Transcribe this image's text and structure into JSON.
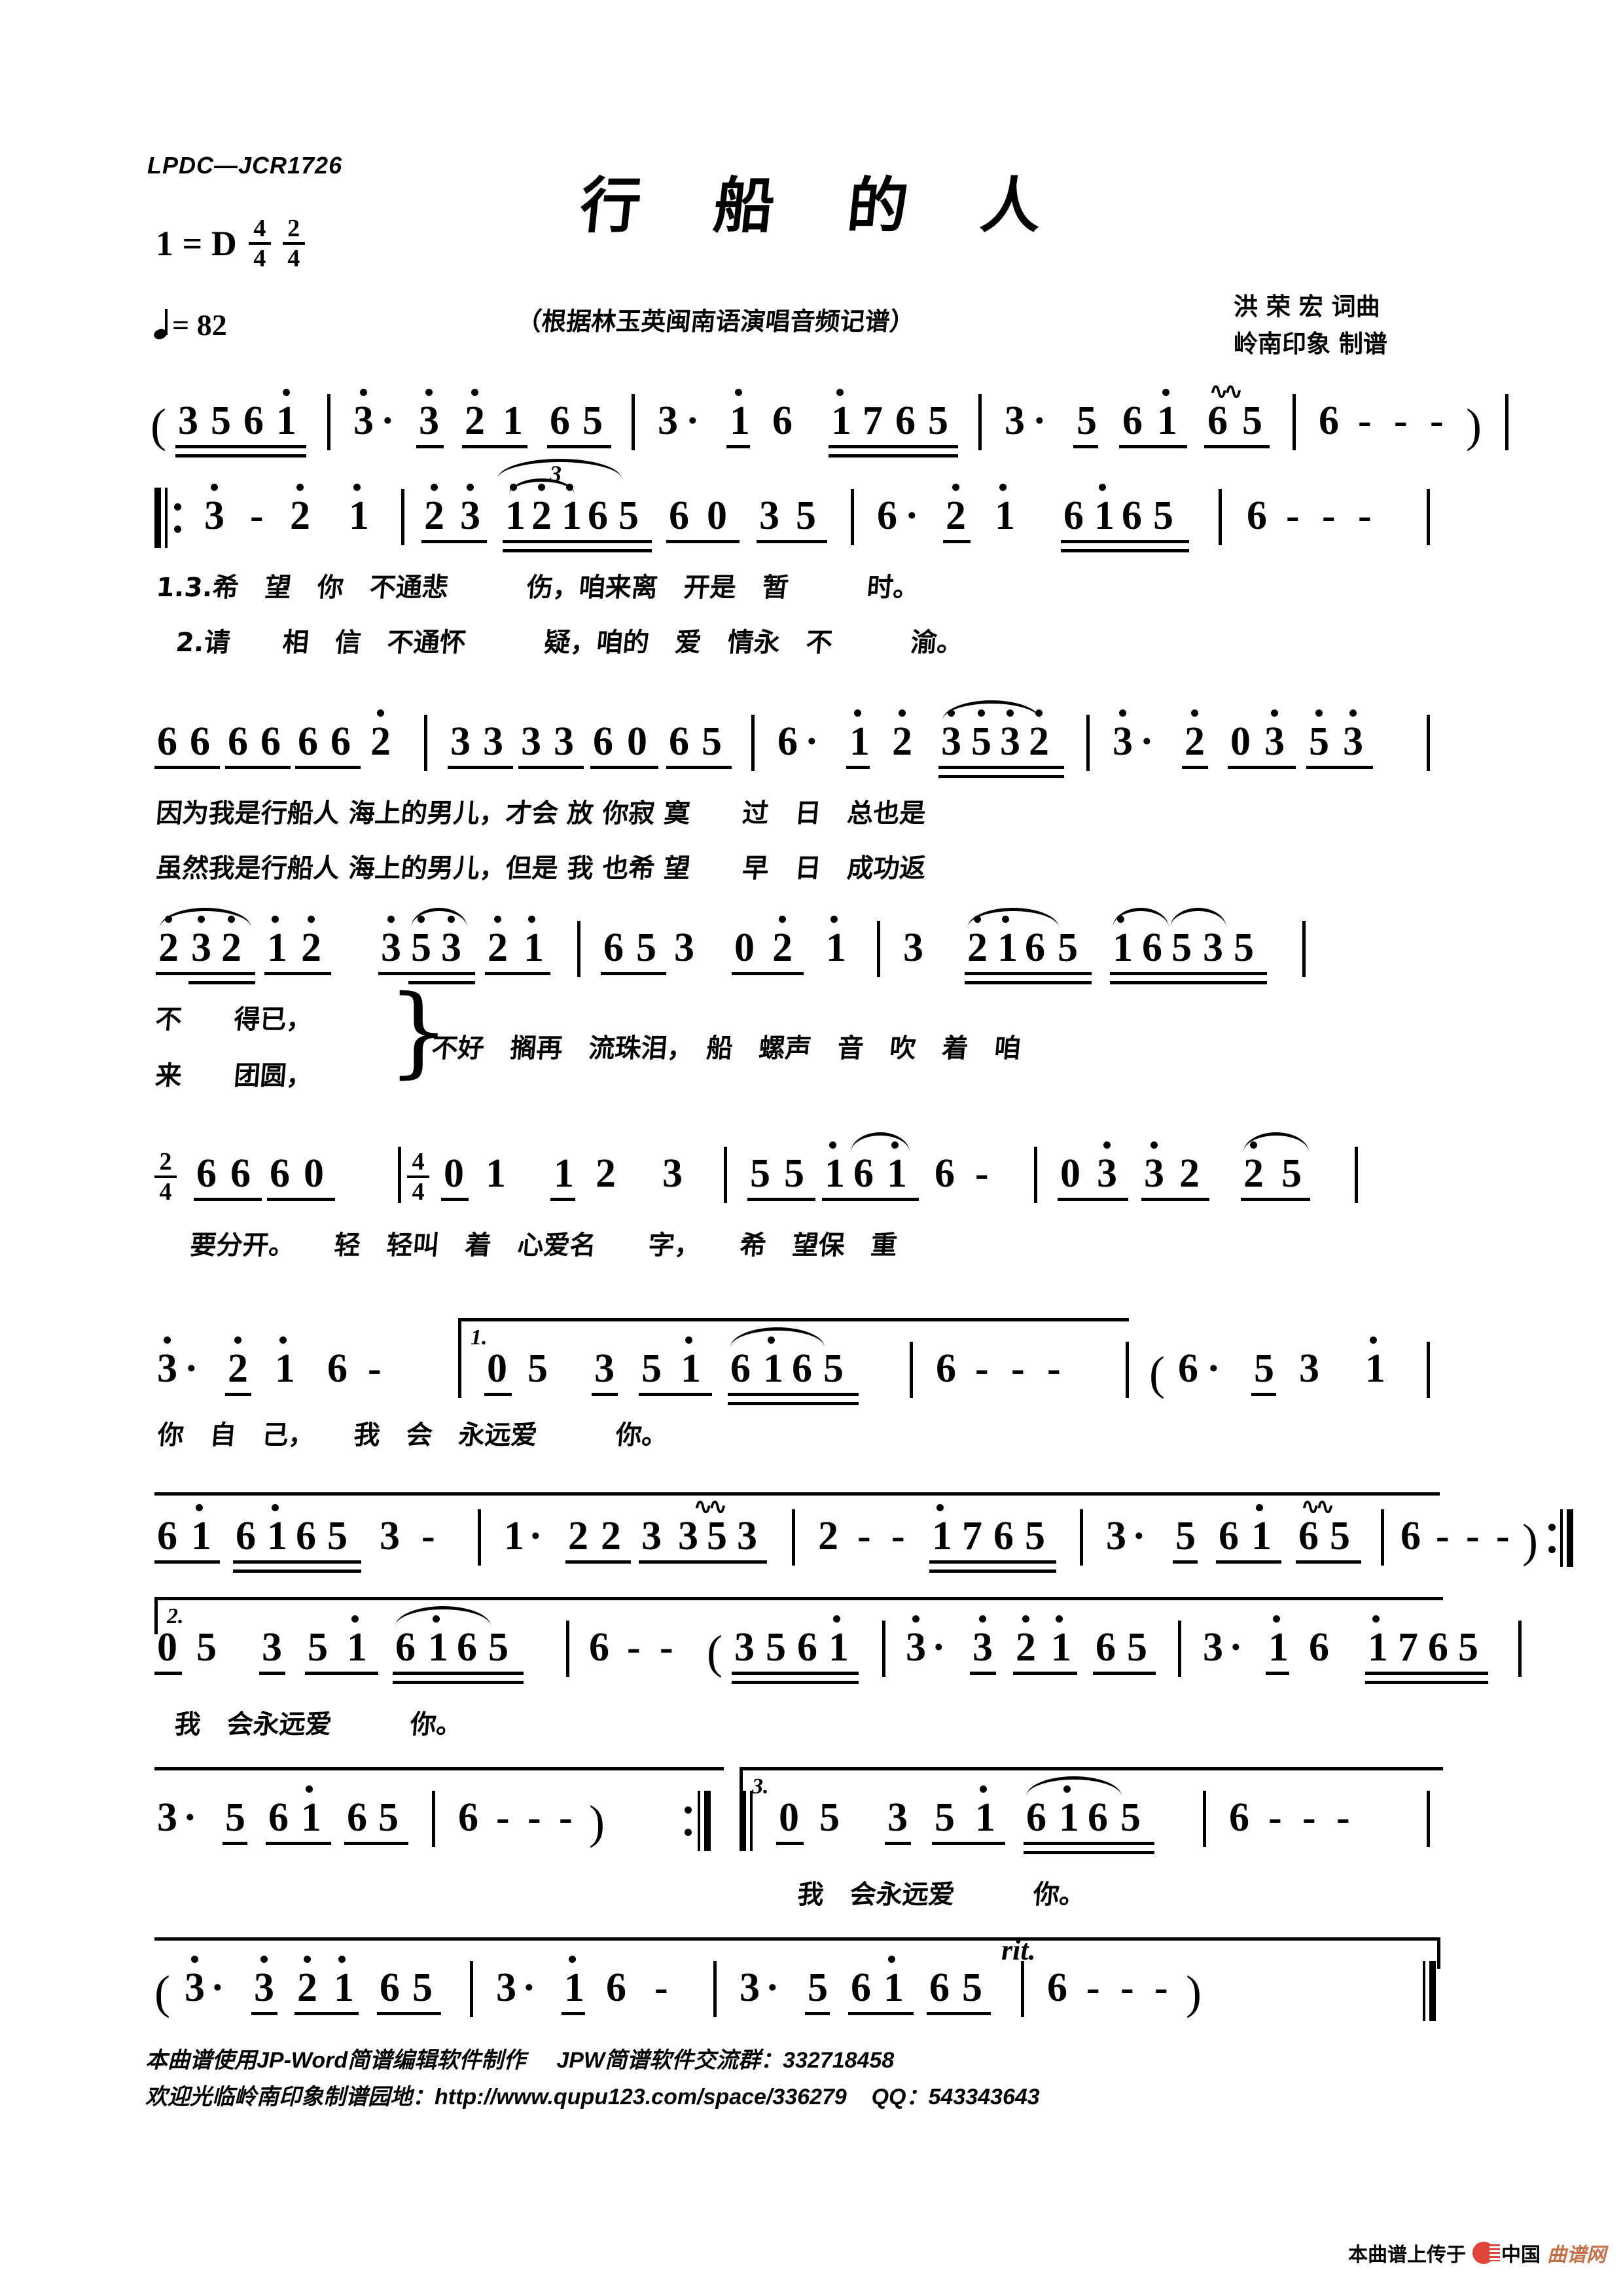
{
  "header": {
    "catalog": "LPDC—JCR1726",
    "title": "行 船 的 人",
    "subtitle": "（根据林玉英闽南语演唱音频记谱）",
    "key_label": "1 = D",
    "time_sig_1": {
      "num": "4",
      "den": "4"
    },
    "time_sig_2": {
      "num": "2",
      "den": "4"
    },
    "tempo_text": "= 82",
    "tempo_note_icon": "quarter-note-icon",
    "credit_lyrics_music": "洪 荣 宏 词曲",
    "credit_arranger": "岭南印象 制谱"
  },
  "score": {
    "systems": [
      {
        "id": "intro",
        "measures": "( 3561 | 3· 3 2 1 6 5 | 3· 1 6 1765 | 3· 5 6 1 6 5 | 6 - - - )",
        "ornament": "mordent",
        "lyrics": []
      },
      {
        "id": "verse-a",
        "measures": "‖: 3 - 2 1 | 2 3 12165 6 0 3 5 | 6· 2 1 6165 | 6 - - -",
        "triplet": "3",
        "lyrics": [
          "1.3.希　望　你　不通悲　　　伤，咱来离　开是　暂　　　时。",
          "2.请　　相　信　不通怀　　　疑，咱的　爱　情永　不　　　渝。"
        ]
      },
      {
        "id": "verse-b",
        "measures": "666666 2 | 3333 6 0 65 | 6· 1 2 3532 | 3· 2 0 3 5 3",
        "lyrics": [
          "因为我是行船人 海上的男儿，才会 放 你寂 寞　　过　日　总也是",
          "虽然我是行船人 海上的男儿，但是 我 也希 望　　早　日　成功返"
        ]
      },
      {
        "id": "verse-c",
        "measures": "232 1 2　353 2 1 | 6 5 3　0 2　1 | 3　2165 16535",
        "lyrics_bracketed": [
          "不　　得已，",
          "来　　团圆，"
        ],
        "lyrics_shared": "不好　搁再　流珠泪，　船　螺声　音　吹　着　咱"
      },
      {
        "id": "chorus-a",
        "time_change_1": {
          "num": "2",
          "den": "4"
        },
        "time_change_2": {
          "num": "4",
          "den": "4"
        },
        "measures": "2/4 6 6 6 0 | 4/4 0 1　1 2　3 | 5 5 1 6 1 6 - | 0 3　3 2　2 5",
        "lyrics": [
          "要分开。　　轻　轻叫　着　心爱名　　字，　　希　望保　重"
        ]
      },
      {
        "id": "chorus-b",
        "volta": "1.",
        "measures": "3· 2 1 6 - | 0 5　3 5 1 6165 | 6 - - - | ( 6·　5 3　1",
        "lyrics": [
          "你　自　己，　　我　会　永远爱　　　你。"
        ]
      },
      {
        "id": "interlude-1",
        "measures": "6 1 6165 3 - | 1· 2 2 3 353 | 2 - - 1765 | 3· 5 6 1 6 5 | 6 - - - ) :‖",
        "ornament": "mordent",
        "lyrics": []
      },
      {
        "id": "chorus-volta2",
        "volta": "2.",
        "measures": "0 5　3 5 1 6165 | 6 - - ( 3561 | 3· 3 2 1 6 5 | 3· 1 6 1765",
        "lyrics": [
          "我　会永远爱　　　你。"
        ]
      },
      {
        "id": "interlude-2",
        "volta": "3.",
        "measures": "3· 5 6 1 6 5 | 6 - - - ) :‖ 0 5　3 5 1 6165 | 6 - - -",
        "lyrics": [
          "我　会永远爱　　　你。"
        ]
      },
      {
        "id": "coda",
        "expression": "rit.",
        "measures": "( 3·　3 2 1 6 5 | 3· 1 6 - | 3· 5 6 1 6 5 | 6 - - - ) ‖",
        "lyrics": []
      }
    ]
  },
  "footer": {
    "line1": "本曲谱使用JP-Word简谱编辑软件制作     JPW简谱软件交流群：332718458",
    "line2": "欢迎光临岭南印象制谱园地：http://www.qupu123.com/space/336279    QQ：543343643"
  },
  "watermark": {
    "prefix": "本曲谱上传于",
    "brand_cn": "中国",
    "brand_qp": "曲谱网",
    "logo_color": "#e0453c",
    "brand_color": "#c3714a"
  }
}
